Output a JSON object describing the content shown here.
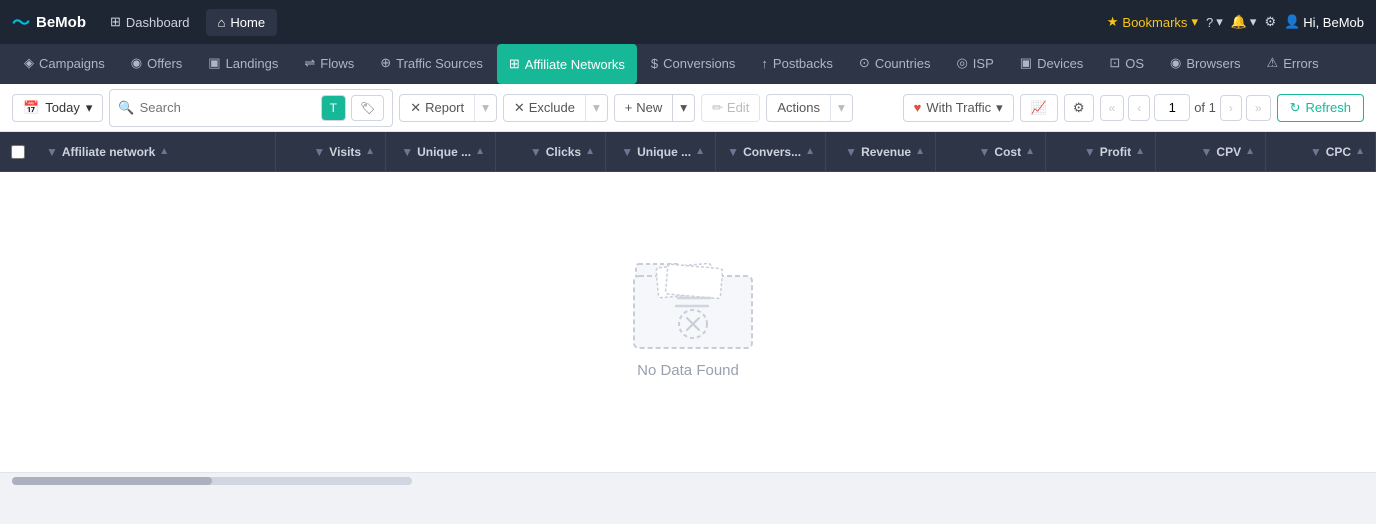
{
  "topNav": {
    "logo": "BeMob",
    "logoIcon": "〜",
    "navItems": [
      {
        "label": "Dashboard",
        "icon": "⊞",
        "active": false
      },
      {
        "label": "Home",
        "icon": "⌂",
        "active": true
      }
    ],
    "bookmarks": "Bookmarks",
    "hiUser": "Hi, BeMob"
  },
  "subNav": {
    "items": [
      {
        "label": "Campaigns",
        "icon": "◈"
      },
      {
        "label": "Offers",
        "icon": "◉"
      },
      {
        "label": "Landings",
        "icon": "▣"
      },
      {
        "label": "Flows",
        "icon": "⇌"
      },
      {
        "label": "Traffic Sources",
        "icon": "⊕"
      },
      {
        "label": "Affiliate Networks",
        "icon": "⊞",
        "active": true
      },
      {
        "label": "Conversions",
        "icon": "$"
      },
      {
        "label": "Postbacks",
        "icon": "↑"
      },
      {
        "label": "Countries",
        "icon": "⊙"
      },
      {
        "label": "ISP",
        "icon": "◎"
      },
      {
        "label": "Devices",
        "icon": "▣"
      },
      {
        "label": "OS",
        "icon": "⊡"
      },
      {
        "label": "Browsers",
        "icon": "◉"
      },
      {
        "label": "Errors",
        "icon": "⚠"
      }
    ]
  },
  "toolbar": {
    "datePicker": "Today",
    "searchPlaceholder": "Search",
    "reportLabel": "Report",
    "excludeLabel": "Exclude",
    "newLabel": "New",
    "editLabel": "Edit",
    "actionsLabel": "Actions",
    "withTrafficLabel": "With Traffic",
    "refreshLabel": "Refresh",
    "pageNumber": "1",
    "pageOf": "of 1"
  },
  "table": {
    "columns": [
      {
        "label": "Affiliate network",
        "type": "main"
      },
      {
        "label": "Visits",
        "type": "numeric"
      },
      {
        "label": "Unique ...",
        "type": "numeric"
      },
      {
        "label": "Clicks",
        "type": "numeric"
      },
      {
        "label": "Unique ...",
        "type": "numeric"
      },
      {
        "label": "Convers...",
        "type": "numeric"
      },
      {
        "label": "Revenue",
        "type": "numeric"
      },
      {
        "label": "Cost",
        "type": "numeric"
      },
      {
        "label": "Profit",
        "type": "numeric"
      },
      {
        "label": "CPV",
        "type": "numeric"
      },
      {
        "label": "CPC",
        "type": "numeric"
      }
    ],
    "emptyState": {
      "message": "No Data Found"
    }
  }
}
